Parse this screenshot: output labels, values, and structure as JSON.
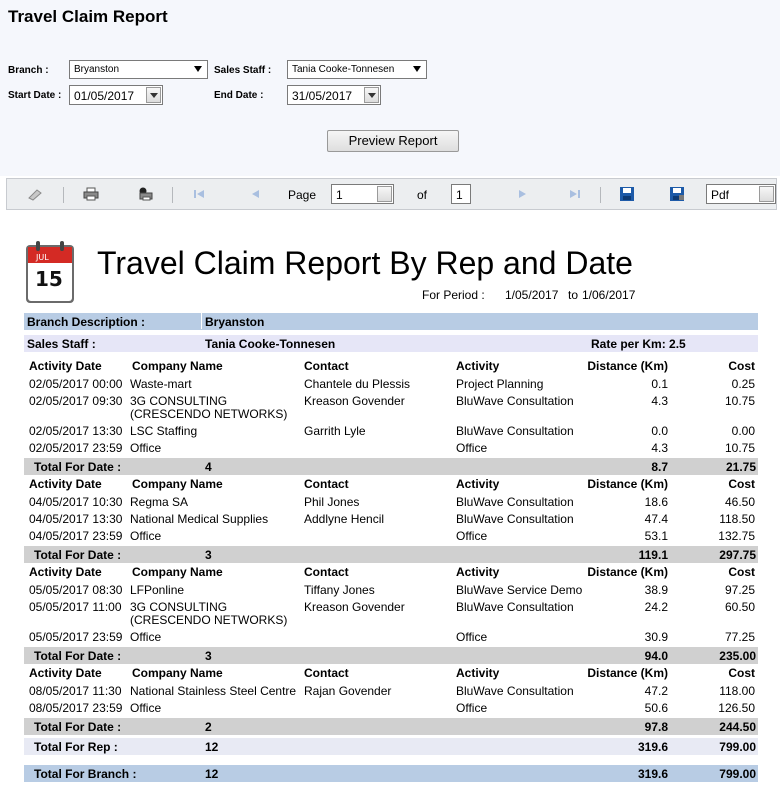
{
  "page_title": "Travel Claim Report",
  "filters": {
    "branch_label": "Branch :",
    "branch_value": "Bryanston",
    "sales_staff_label": "Sales Staff :",
    "sales_staff_value": "Tania Cooke-Tonnesen",
    "start_date_label": "Start Date :",
    "start_date_value": "01/05/2017",
    "end_date_label": "End Date :",
    "end_date_value": "31/05/2017",
    "preview_label": "Preview Report"
  },
  "toolbar": {
    "page_label": "Page",
    "page_value": "1",
    "of_label": "of",
    "total_pages": "1",
    "export_format": "Pdf",
    "icons": [
      "toggle-icon",
      "print-icon",
      "print-setup-icon",
      "first-page-icon",
      "previous-page-icon",
      "next-page-icon",
      "last-page-icon",
      "save-icon",
      "export-icon"
    ]
  },
  "report": {
    "logo_month": "JUL",
    "logo_day": "15",
    "title": "Travel Claim Report By Rep and Date",
    "period_label": "For Period :",
    "period_from": "1/05/2017",
    "period_to_label": "to",
    "period_to": "1/06/2017",
    "branch_desc_label": "Branch Description :",
    "branch_desc_value": "Bryanston",
    "sales_staff_label": "Sales Staff :",
    "sales_staff_value": "Tania Cooke-Tonnesen",
    "rate_label": "Rate per Km: 2.5",
    "headers": {
      "date": "Activity Date",
      "company": "Company Name",
      "contact": "Contact",
      "activity": "Activity",
      "distance": "Distance (Km)",
      "cost": "Cost"
    },
    "groups": [
      {
        "rows": [
          {
            "date": "02/05/2017 00:00",
            "company": "Waste-mart",
            "company2": "",
            "contact": "Chantele  du Plessis",
            "activity": "Project Planning",
            "distance": "0.1",
            "cost": "0.25"
          },
          {
            "date": "02/05/2017 09:30",
            "company": "3G CONSULTING",
            "company2": "(CRESCENDO NETWORKS)",
            "contact": "Kreason Govender",
            "activity": "BluWave Consultation",
            "distance": "4.3",
            "cost": "10.75"
          },
          {
            "date": "02/05/2017 13:30",
            "company": "LSC Staffing",
            "company2": "",
            "contact": "Garrith Lyle",
            "activity": "BluWave Consultation",
            "distance": "0.0",
            "cost": "0.00"
          },
          {
            "date": "02/05/2017 23:59",
            "company": "Office",
            "company2": "",
            "contact": "",
            "activity": "Office",
            "distance": "4.3",
            "cost": "10.75"
          }
        ],
        "total_label": "Total For Date :",
        "total_count": "4",
        "total_distance": "8.7",
        "total_cost": "21.75"
      },
      {
        "rows": [
          {
            "date": "04/05/2017 10:30",
            "company": "Regma SA",
            "company2": "",
            "contact": "Phil Jones",
            "activity": "BluWave Consultation",
            "distance": "18.6",
            "cost": "46.50"
          },
          {
            "date": "04/05/2017 13:30",
            "company": "National Medical Supplies",
            "company2": "",
            "contact": "Addlyne Hencil",
            "activity": "BluWave Consultation",
            "distance": "47.4",
            "cost": "118.50"
          },
          {
            "date": "04/05/2017 23:59",
            "company": "Office",
            "company2": "",
            "contact": "",
            "activity": "Office",
            "distance": "53.1",
            "cost": "132.75"
          }
        ],
        "total_label": "Total For Date :",
        "total_count": "3",
        "total_distance": "119.1",
        "total_cost": "297.75"
      },
      {
        "rows": [
          {
            "date": "05/05/2017 08:30",
            "company": "LFPonline",
            "company2": "",
            "contact": "Tiffany Jones",
            "activity": "BluWave Service Demo",
            "distance": "38.9",
            "cost": "97.25"
          },
          {
            "date": "05/05/2017 11:00",
            "company": "3G CONSULTING",
            "company2": "(CRESCENDO NETWORKS)",
            "contact": "Kreason Govender",
            "activity": "BluWave Consultation",
            "distance": "24.2",
            "cost": "60.50"
          },
          {
            "date": "05/05/2017 23:59",
            "company": "Office",
            "company2": "",
            "contact": "",
            "activity": "Office",
            "distance": "30.9",
            "cost": "77.25"
          }
        ],
        "total_label": "Total For Date :",
        "total_count": "3",
        "total_distance": "94.0",
        "total_cost": "235.00"
      },
      {
        "rows": [
          {
            "date": "08/05/2017 11:30",
            "company": "National Stainless Steel Centre",
            "company2": "",
            "contact": "Rajan  Govender",
            "activity": "BluWave Consultation",
            "distance": "47.2",
            "cost": "118.00"
          },
          {
            "date": "08/05/2017 23:59",
            "company": "Office",
            "company2": "",
            "contact": "",
            "activity": "Office",
            "distance": "50.6",
            "cost": "126.50"
          }
        ],
        "total_label": "Total For Date :",
        "total_count": "2",
        "total_distance": "97.8",
        "total_cost": "244.50"
      }
    ],
    "rep_total": {
      "label": "Total For Rep :",
      "count": "12",
      "distance": "319.6",
      "cost": "799.00"
    },
    "branch_total": {
      "label": "Total For Branch :",
      "count": "12",
      "distance": "319.6",
      "cost": "799.00"
    },
    "colors": {
      "band_blue": "#b8cce4",
      "band_grey": "#d0d0d0",
      "band_lavender": "#e6e6f7",
      "band_light": "#e8eaf4"
    }
  }
}
